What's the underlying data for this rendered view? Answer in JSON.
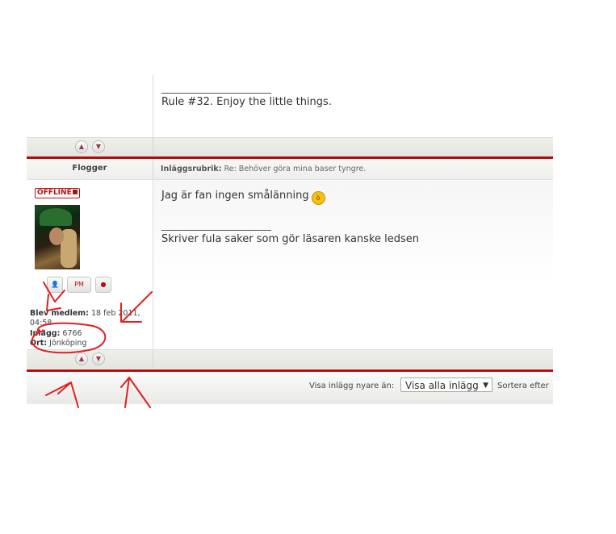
{
  "post1": {
    "signature": "Rule #32. Enjoy the little things."
  },
  "post2": {
    "author": "Flogger",
    "subject_label": "Inläggsrubrik:",
    "subject": "Re: Behöver göra mina baser tyngre.",
    "status": "OFFLINE",
    "message": "Jag är fan ingen smålänning",
    "signature": "Skriver fula saker som gör läsaren kanske ledsen",
    "member_since_label": "Blev medlem:",
    "member_since": "18 feb 2011, 04:58",
    "posts_label": "Inlägg:",
    "posts": "6766",
    "location_label": "Ort:",
    "location": "Jönköping",
    "pm_label": "PM"
  },
  "footer": {
    "show_newer_label": "Visa inlägg nyare än:",
    "show_newer_value": "Visa alla inlägg",
    "sort_label": "Sortera efter"
  },
  "icons": {
    "up": "arrow-up-icon",
    "down": "arrow-down-icon",
    "profile": "profile-icon",
    "pm": "private-message-icon",
    "www": "website-icon",
    "emoji": "devil-smiley-icon"
  },
  "colors": {
    "accent": "#b30e0e",
    "annotation": "#e02020"
  }
}
